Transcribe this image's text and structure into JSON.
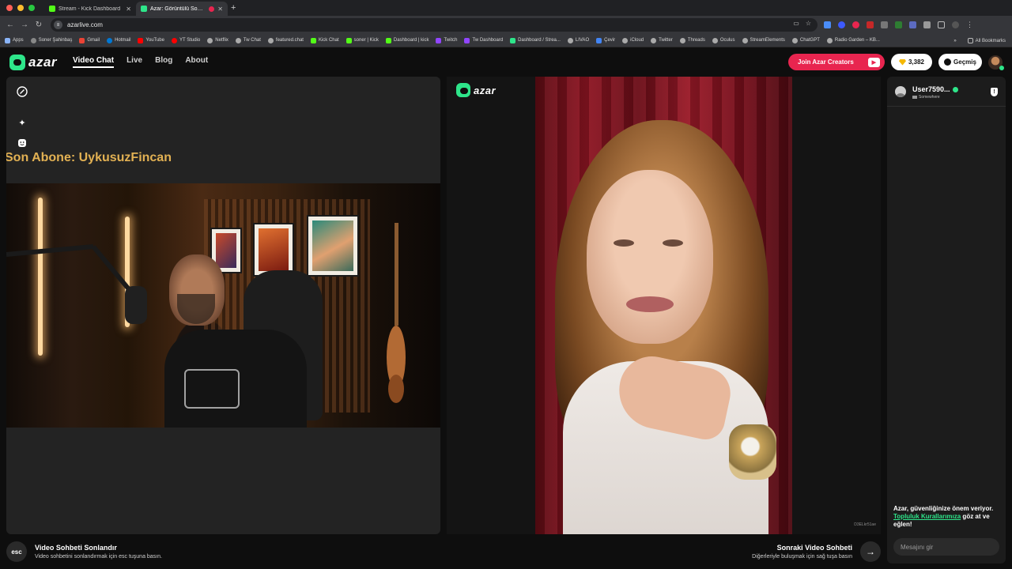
{
  "browser": {
    "tabs": [
      {
        "label": "Stream - Kick Dashboard",
        "favicon_color": "#53fc18",
        "active": false
      },
      {
        "label": "Azar: Görüntülü Sohbet, ",
        "favicon_color": "#2ee58a",
        "active": true
      }
    ],
    "url": "azarlive.com",
    "bookmarks": [
      {
        "label": "Apps",
        "color": "#8ab4f8"
      },
      {
        "label": "Soner Şahinbaş",
        "color": "#888888"
      },
      {
        "label": "Gmail",
        "color": "#ea4335"
      },
      {
        "label": "Hotmail",
        "color": "#0078d4"
      },
      {
        "label": "YouTube",
        "color": "#ff0000"
      },
      {
        "label": "YT Studio",
        "color": "#ff0000"
      },
      {
        "label": "Netflix",
        "color": "#aaaaaa"
      },
      {
        "label": "Tw Chat",
        "color": "#aaaaaa"
      },
      {
        "label": "featured.chat",
        "color": "#aaaaaa"
      },
      {
        "label": "Kick Chat",
        "color": "#53fc18"
      },
      {
        "label": "soner | Kick",
        "color": "#53fc18"
      },
      {
        "label": "Dashboard | kick",
        "color": "#53fc18"
      },
      {
        "label": "Twitch",
        "color": "#9146ff"
      },
      {
        "label": "Tw Dashboard",
        "color": "#9146ff"
      },
      {
        "label": "Dashboard / Strea...",
        "color": "#2ee58a"
      },
      {
        "label": "LIVAO",
        "color": "#aaaaaa"
      },
      {
        "label": "Çevir",
        "color": "#4285f4"
      },
      {
        "label": "iCloud",
        "color": "#aaaaaa"
      },
      {
        "label": "Twitter",
        "color": "#aaaaaa"
      },
      {
        "label": "Threads",
        "color": "#aaaaaa"
      },
      {
        "label": "Oculus",
        "color": "#aaaaaa"
      },
      {
        "label": "StreamElements",
        "color": "#aaaaaa"
      },
      {
        "label": "ChatGPT",
        "color": "#aaaaaa"
      },
      {
        "label": "Radio Garden – KB...",
        "color": "#aaaaaa"
      }
    ],
    "bookmarks_more": "»",
    "all_bookmarks": "All Bookmarks"
  },
  "site": {
    "logo_text": "azar",
    "nav": [
      "Video Chat",
      "Live",
      "Blog",
      "About"
    ],
    "creators_label": "Join Azar Creators",
    "gems": "3,382",
    "history_label": "Geçmiş",
    "accent": "#2ee58a",
    "brand_red": "#e8254f"
  },
  "stream": {
    "ticker": "Son Abone: UykusuzFincan"
  },
  "remote": {
    "logo_text": "azar",
    "id_watermark": "D3ELkr51ae"
  },
  "bottom": {
    "esc_key": "esc",
    "end_title": "Video Sohbeti Sonlandır",
    "end_sub": "Video sohbetini sonlandırmak için esc tuşuna basın.",
    "next_title": "Sonraki Video Sohbeti",
    "next_sub": "Diğerleriyle buluşmak için sağ tuşa basın",
    "next_arrow": "→"
  },
  "chat": {
    "username": "User7590...",
    "location": "Somewhere",
    "safety_prefix": "Azar, güvenliğinize önem veriyor. ",
    "safety_link": "Topluluk Kurallarımıza",
    "safety_suffix": " göz at ve eğlen!",
    "input_placeholder": "Mesajını gir"
  }
}
